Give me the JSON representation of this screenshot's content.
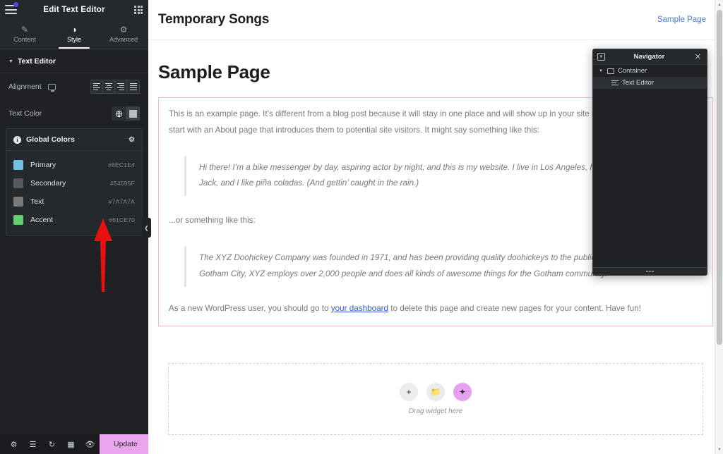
{
  "panel": {
    "title": "Edit Text Editor",
    "menu_icon": "hamburger-icon",
    "apps_icon": "grid-icon",
    "tabs": [
      {
        "label": "Content",
        "icon": "pencil-icon",
        "active": false
      },
      {
        "label": "Style",
        "icon": "contrast-icon",
        "active": true
      },
      {
        "label": "Advanced",
        "icon": "gear-icon",
        "active": false
      }
    ],
    "section": {
      "title": "Text Editor"
    },
    "controls": {
      "alignment_label": "Alignment",
      "alignment_options": [
        "align-left",
        "align-center",
        "align-right",
        "align-justify"
      ],
      "text_color_label": "Text Color"
    },
    "global_colors": {
      "title": "Global Colors",
      "items": [
        {
          "name": "Primary",
          "hex": "#6EC1E4",
          "swatch": "#6EC1E4"
        },
        {
          "name": "Secondary",
          "hex": "#54595F",
          "swatch": "#54595F"
        },
        {
          "name": "Text",
          "hex": "#7A7A7A",
          "swatch": "#7A7A7A"
        },
        {
          "name": "Accent",
          "hex": "#61CE70",
          "swatch": "#61CE70"
        }
      ]
    },
    "footer": {
      "icons": [
        "settings-icon",
        "layers-icon",
        "history-icon",
        "responsive-icon",
        "preview-icon"
      ],
      "update_label": "Update",
      "update_color": "#EBA5EE"
    },
    "collapse_label": "❮"
  },
  "canvas": {
    "site_title": "Temporary Songs",
    "nav_link": "Sample Page",
    "page_heading": "Sample Page",
    "text_widget": {
      "paragraph1": "This is an example page. It's different from a blog post because it will stay in one place and will show up in your site navigation",
      "paragraph1_line2": "start with an About page that introduces them to potential site visitors. It might say something like this:",
      "quote1_line1": "Hi there! I’m a bike messenger by day, aspiring actor by night, and this is my website. I live in Los Angeles, have",
      "quote1_line2": "Jack, and I like piña coladas. (And gettin’ caught in the rain.)",
      "transition": "...or something like this:",
      "quote2_line1": "The XYZ Doohickey Company was founded in 1971, and has been providing quality doohickeys to the public eve",
      "quote2_line2": "Gotham City, XYZ employs over 2,000 people and does all kinds of awesome things for the Gotham community.",
      "last_before": "As a new WordPress user, you should go to ",
      "last_link": "your dashboard",
      "last_after": " to delete this page and create new pages for your content. Have fun!"
    },
    "dropzone": {
      "add_label": "+",
      "folder_label": "📁",
      "ai_label": "✦",
      "caption": "Drag widget here"
    }
  },
  "navigator": {
    "title": "Navigator",
    "dock_icon": "dock-icon",
    "close_icon": "close-icon",
    "items": [
      {
        "label": "Container",
        "level": 1,
        "icon": "container-icon",
        "selected": false
      },
      {
        "label": "Text Editor",
        "level": 2,
        "icon": "text-editor-icon",
        "selected": true
      }
    ]
  },
  "annotation": {
    "arrow": "red-up-arrow",
    "color": "#E8110F"
  }
}
